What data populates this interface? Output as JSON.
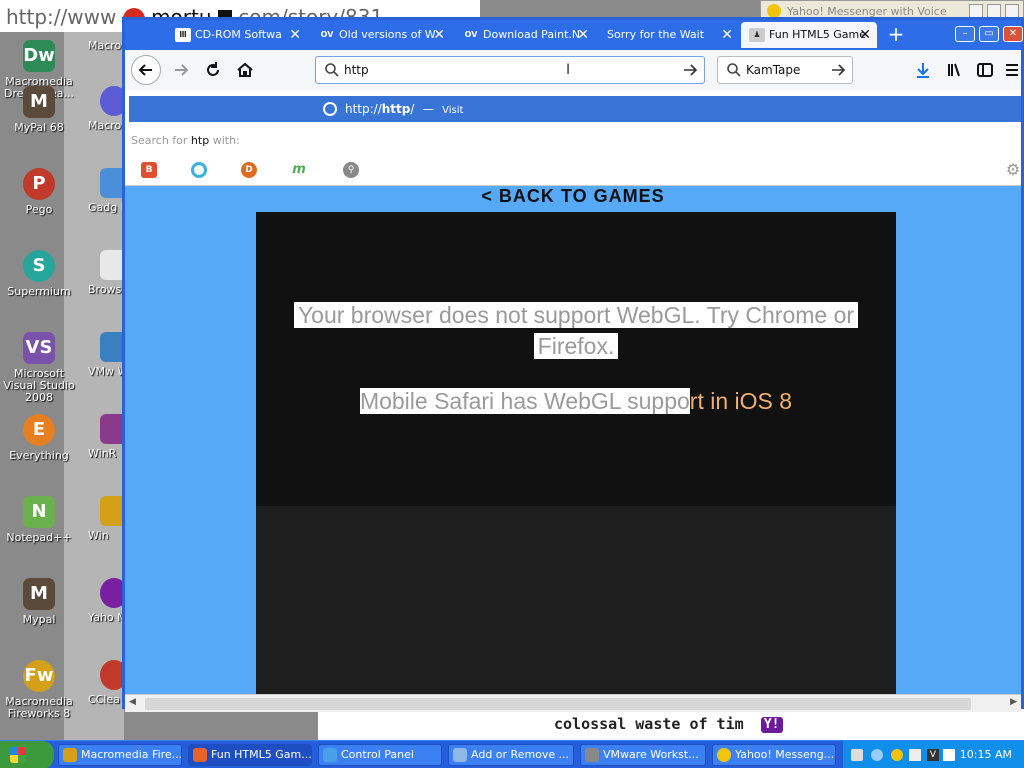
{
  "back_window": {
    "url_fragment": "http://www",
    "url_fragment_2": "mortu",
    "url_fragment_3": "com/story/831",
    "yahoo_title": "Yahoo! Messenger with Voice",
    "doc_text": "colossal waste of tim"
  },
  "desktop": {
    "icons": [
      {
        "label": "Macromedia Dreamwea...",
        "color": "#2e8b57",
        "glyph": "Dw"
      },
      {
        "label": "MyPal 68",
        "color": "#5a4a3a",
        "glyph": "M"
      },
      {
        "label": "Pego",
        "color": "#c0392b",
        "glyph": "P"
      },
      {
        "label": "Supermium",
        "color": "#26a69a",
        "glyph": "S"
      },
      {
        "label": "Microsoft Visual Studio 2008",
        "color": "#7b52ab",
        "glyph": "VS"
      },
      {
        "label": "Everything",
        "color": "#e67e22",
        "glyph": "E"
      },
      {
        "label": "Notepad++",
        "color": "#6ab04c",
        "glyph": "N"
      },
      {
        "label": "Mypal",
        "color": "#5a4a3a",
        "glyph": "M"
      },
      {
        "label": "Macromedia Fireworks 8",
        "color": "#d4a017",
        "glyph": "Fw"
      }
    ],
    "icons2": [
      {
        "label": "Macro Flash"
      },
      {
        "label": "Macro Contrib"
      },
      {
        "label": "Gadg Extra"
      },
      {
        "label": "Browser"
      },
      {
        "label": "VMw Works"
      },
      {
        "label": "WinR"
      },
      {
        "label": "Win"
      },
      {
        "label": "Yaho Messe"
      },
      {
        "label": "CClea"
      }
    ]
  },
  "browser": {
    "tabs": [
      {
        "label": "CD-ROM Softwa",
        "icon": "museum-icon"
      },
      {
        "label": "Old versions of W",
        "icon": "ov-icon"
      },
      {
        "label": "Download Paint.N",
        "icon": "ov-icon"
      },
      {
        "label": "Sorry for the Wait",
        "icon": ""
      },
      {
        "label": "Fun HTML5 Game",
        "icon": "game-icon"
      }
    ],
    "url_value": "http",
    "search_value": "KamTape",
    "dropdown": {
      "url": "http://",
      "url_bold": "http",
      "url_suffix": "/",
      "dash": "—",
      "visit": "Visit",
      "search_for": "Search for",
      "search_term": "htp",
      "with": "with:"
    },
    "page": {
      "back_link": "< BACK TO GAMES",
      "msg1_line1": "Your browser does not support WebGL. Try Chrome or",
      "msg1_line2": "Firefox.",
      "msg2_hl": "Mobile Safari has WebGL suppo",
      "msg2_rest": "rt in iOS 8"
    }
  },
  "taskbar": {
    "start": "start",
    "tasks": [
      {
        "label": "Macromedia Fire...",
        "color": "#d4a017"
      },
      {
        "label": "Fun HTML5 Gam...",
        "color": "#e8622c"
      },
      {
        "label": "Control Panel",
        "color": "#4aa0e8"
      },
      {
        "label": "Add or Remove ...",
        "color": "#8fb8e8"
      },
      {
        "label": "VMware Workst...",
        "color": "#888888"
      },
      {
        "label": "Yahoo! Messeng...",
        "color": "#f1c40f"
      }
    ],
    "clock": "10:15 AM"
  },
  "colors": {
    "firefox_blue": "#2d6ee8",
    "page_bg": "#55a9f7",
    "game_bg": "#111111",
    "orange_text": "#f0b070"
  }
}
